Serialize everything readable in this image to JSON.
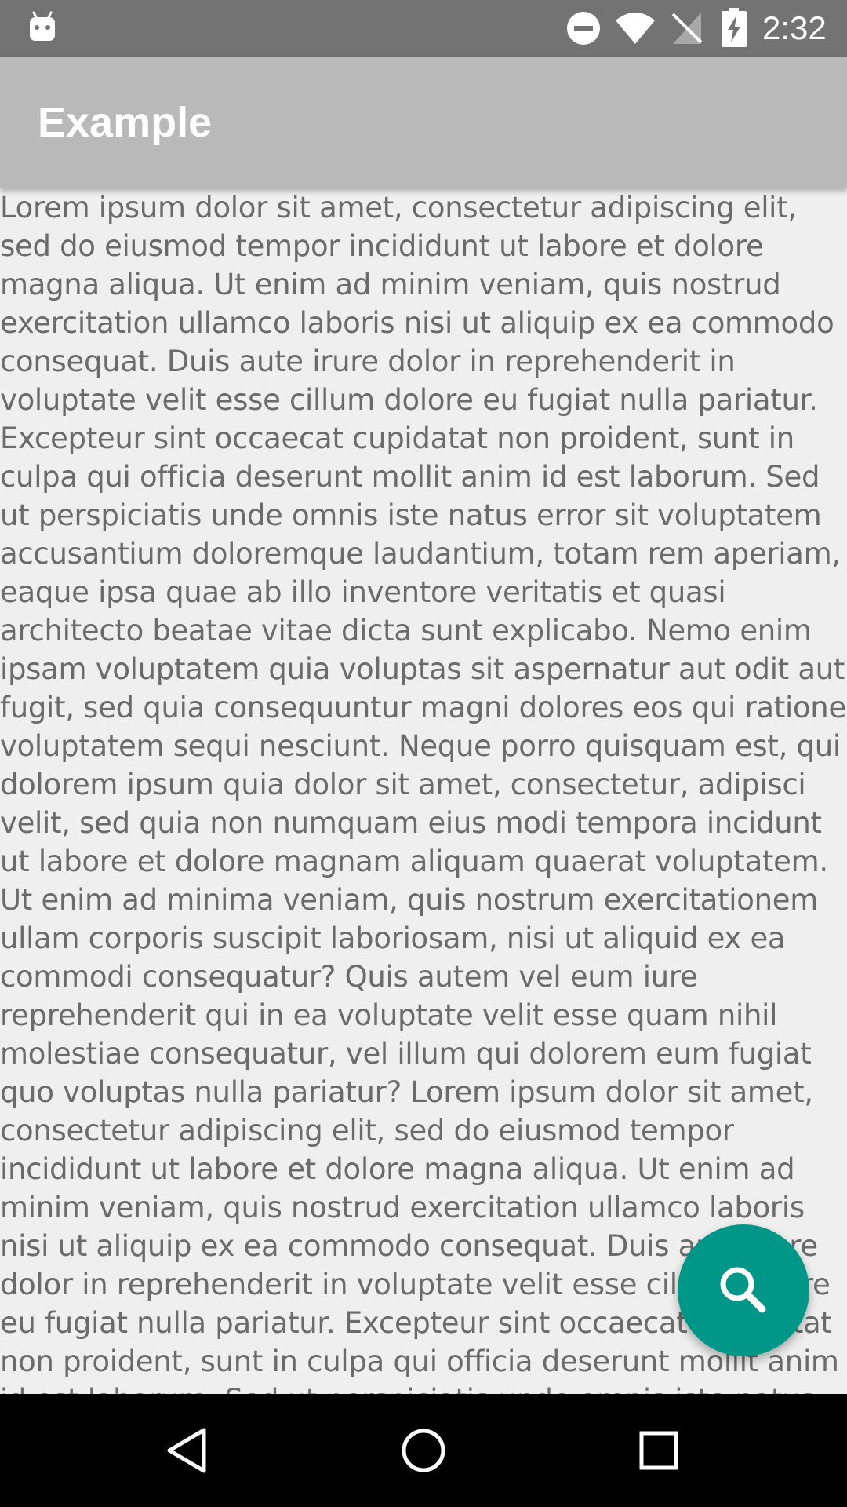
{
  "status_bar": {
    "time": "2:32",
    "icons": [
      "android-icon",
      "do-not-disturb-icon",
      "wifi-icon",
      "no-signal-icon",
      "battery-charging-icon"
    ],
    "background": "#737373"
  },
  "app_bar": {
    "title": "Example",
    "background": "#b9b9b9"
  },
  "content": {
    "text": "Lorem ipsum dolor sit amet, consectetur adipiscing elit, sed do eiusmod tempor incididunt ut labore et dolore magna aliqua. Ut enim ad minim veniam, quis nostrud exercitation ullamco laboris nisi ut aliquip ex ea commodo consequat. Duis aute irure dolor in reprehenderit in voluptate velit esse cillum dolore eu fugiat nulla pariatur. Excepteur sint occaecat cupidatat non proident, sunt in culpa qui officia deserunt mollit anim id est laborum. Sed ut perspiciatis unde omnis iste natus error sit voluptatem accusantium doloremque laudantium, totam rem aperiam, eaque ipsa quae ab illo inventore veritatis et quasi architecto beatae vitae dicta sunt explicabo. Nemo enim ipsam voluptatem quia voluptas sit aspernatur aut odit aut fugit, sed quia consequuntur magni dolores eos qui ratione voluptatem sequi nesciunt. Neque porro quisquam est, qui dolorem ipsum quia dolor sit amet, consectetur, adipisci velit, sed quia non numquam eius modi tempora incidunt ut labore et dolore magnam aliquam quaerat voluptatem. Ut enim ad minima veniam, quis nostrum exercitationem ullam corporis suscipit laboriosam, nisi ut aliquid ex ea commodi consequatur? Quis autem vel eum iure reprehenderit qui in ea voluptate velit esse quam nihil molestiae consequatur, vel illum qui dolorem eum fugiat quo voluptas nulla pariatur? Lorem ipsum dolor sit amet, consectetur adipiscing elit, sed do eiusmod tempor incididunt ut labore et dolore magna aliqua. Ut enim ad minim veniam, quis nostrud exercitation ullamco laboris nisi ut aliquip ex ea commodo consequat. Duis aute irure dolor in reprehenderit in voluptate velit esse cillum dolore eu fugiat nulla pariatur. Excepteur sint occaecat cupidatat non proident, sunt in culpa qui officia deserunt mollit anim id est laborum. Sed ut perspiciatis unde omnis iste natus error sit voluptatem",
    "text_color": "#6b6b6b",
    "background": "#efefef"
  },
  "fab": {
    "icon": "search-icon",
    "color": "#009688"
  },
  "nav_bar": {
    "buttons": [
      "back-icon",
      "home-icon",
      "recents-icon"
    ],
    "background": "#000000"
  }
}
